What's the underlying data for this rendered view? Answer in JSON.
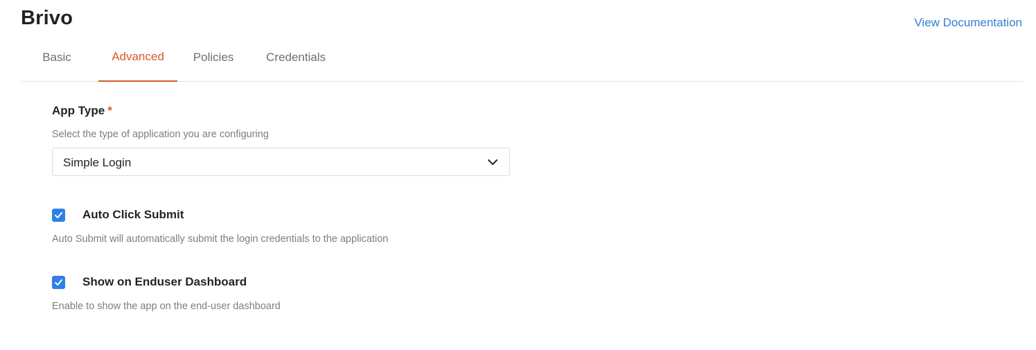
{
  "header": {
    "title": "Brivo",
    "doc_link": "View Documentation"
  },
  "tabs": [
    {
      "label": "Basic",
      "active": false
    },
    {
      "label": "Advanced",
      "active": true
    },
    {
      "label": "Policies",
      "active": false
    },
    {
      "label": "Credentials",
      "active": false
    }
  ],
  "app_type": {
    "label": "App Type",
    "required_mark": "*",
    "help": "Select the type of application you are configuring",
    "selected": "Simple Login",
    "icon": "chevron-down-icon"
  },
  "auto_click_submit": {
    "label": "Auto Click Submit",
    "checked": true,
    "help": "Auto Submit will automatically submit the login credentials to the application"
  },
  "show_on_dashboard": {
    "label": "Show on Enduser Dashboard",
    "checked": true,
    "help": "Enable to show the app on the end-user dashboard"
  },
  "colors": {
    "accent": "#d9582b",
    "link": "#2f7fd1",
    "checkbox": "#2f7fe8"
  }
}
